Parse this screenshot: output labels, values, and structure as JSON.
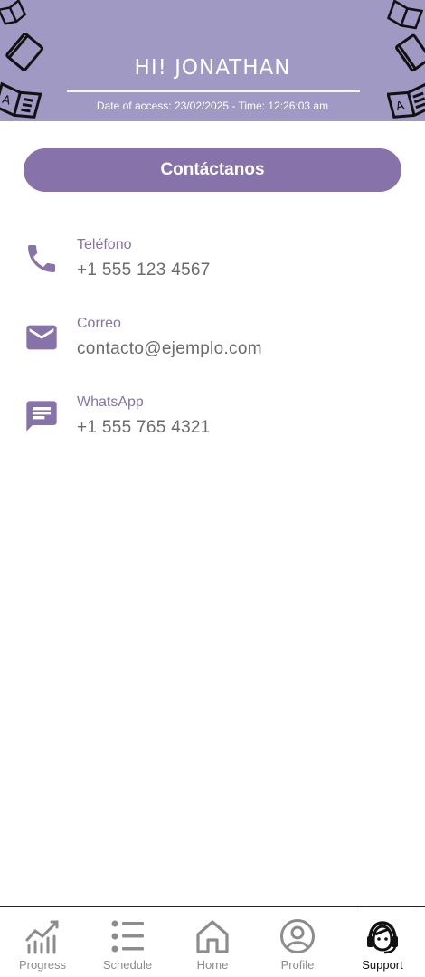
{
  "header": {
    "greeting": "HI! JONATHAN",
    "access_text": "Date of access: 23/02/2025 - Time: 12:26:03 am",
    "background_color": "#9f99c4"
  },
  "contact_button": {
    "label": "Contáctanos",
    "color": "#8772a9"
  },
  "contacts": [
    {
      "icon": "phone-icon",
      "label": "Teléfono",
      "value": "+1 555 123 4567"
    },
    {
      "icon": "mail-icon",
      "label": "Correo",
      "value": "contacto@ejemplo.com"
    },
    {
      "icon": "message-icon",
      "label": "WhatsApp",
      "value": "+1 555 765 4321"
    }
  ],
  "nav": {
    "items": [
      {
        "icon": "progress-chart-icon",
        "label": "Progress",
        "active": false
      },
      {
        "icon": "list-icon",
        "label": "Schedule",
        "active": false
      },
      {
        "icon": "home-icon",
        "label": "Home",
        "active": false
      },
      {
        "icon": "profile-icon",
        "label": "Profile",
        "active": false
      },
      {
        "icon": "support-headset-icon",
        "label": "Support",
        "active": true
      }
    ]
  }
}
